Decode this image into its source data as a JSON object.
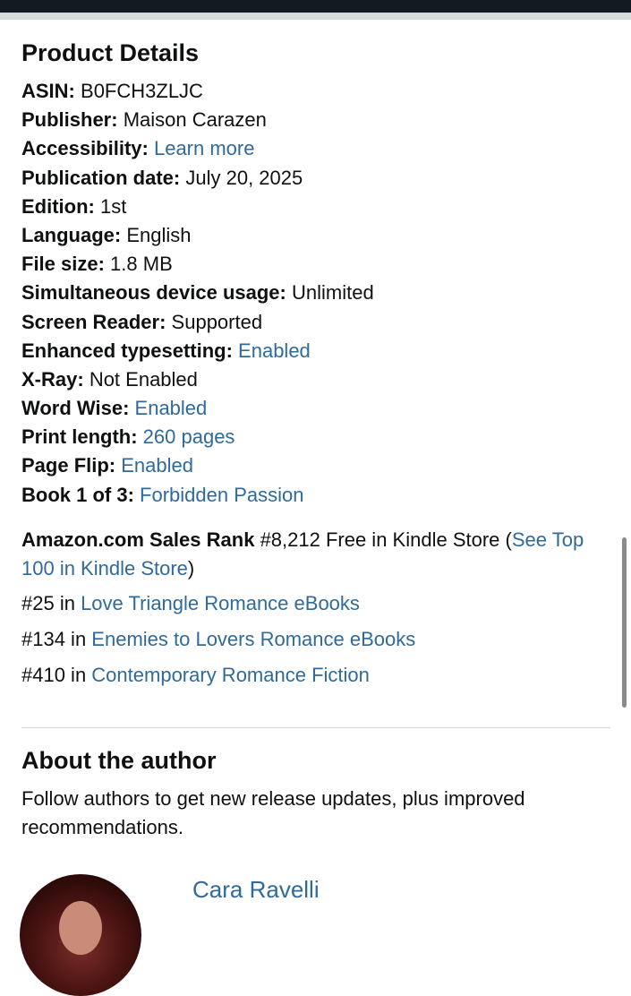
{
  "product_details": {
    "title": "Product Details",
    "rows": [
      {
        "label": "ASIN:",
        "value": "B0FCH3ZLJC",
        "is_link": false
      },
      {
        "label": "Publisher:",
        "value": "Maison Carazen",
        "is_link": false
      },
      {
        "label": "Accessibility:",
        "value": "Learn more",
        "is_link": true
      },
      {
        "label": "Publication date:",
        "value": "July 20, 2025",
        "is_link": false
      },
      {
        "label": "Edition:",
        "value": "1st",
        "is_link": false
      },
      {
        "label": "Language:",
        "value": "English",
        "is_link": false
      },
      {
        "label": "File size:",
        "value": "1.8 MB",
        "is_link": false
      },
      {
        "label": "Simultaneous device usage:",
        "value": "Unlimited",
        "is_link": false
      },
      {
        "label": "Screen Reader:",
        "value": "Supported",
        "is_link": false
      },
      {
        "label": "Enhanced typesetting:",
        "value": "Enabled",
        "is_link": true
      },
      {
        "label": "X-Ray:",
        "value": "Not Enabled",
        "is_link": false
      },
      {
        "label": "Word Wise:",
        "value": "Enabled",
        "is_link": true
      },
      {
        "label": "Print length:",
        "value": "260 pages",
        "is_link": true
      },
      {
        "label": "Page Flip:",
        "value": "Enabled",
        "is_link": true
      },
      {
        "label": "Book 1 of 3:",
        "value": "Forbidden Passion",
        "is_link": true
      }
    ]
  },
  "sales_rank": {
    "label": "Amazon.com Sales Rank",
    "value": "#8,212 Free in Kindle Store (",
    "link": "See Top 100 in Kindle Store",
    "close": ")",
    "categories": [
      {
        "rank": "#25 in ",
        "name": "Love Triangle Romance eBooks"
      },
      {
        "rank": "#134 in ",
        "name": "Enemies to Lovers Romance eBooks"
      },
      {
        "rank": "#410 in ",
        "name": "Contemporary Romance Fiction"
      }
    ]
  },
  "about_author": {
    "title": "About the author",
    "text": "Follow authors to get new release updates, plus improved recommendations.",
    "author_name": "Cara Ravelli"
  },
  "colors": {
    "link": "#2f6a9b",
    "text": "#0f1111",
    "top_bar": "#131a22"
  }
}
